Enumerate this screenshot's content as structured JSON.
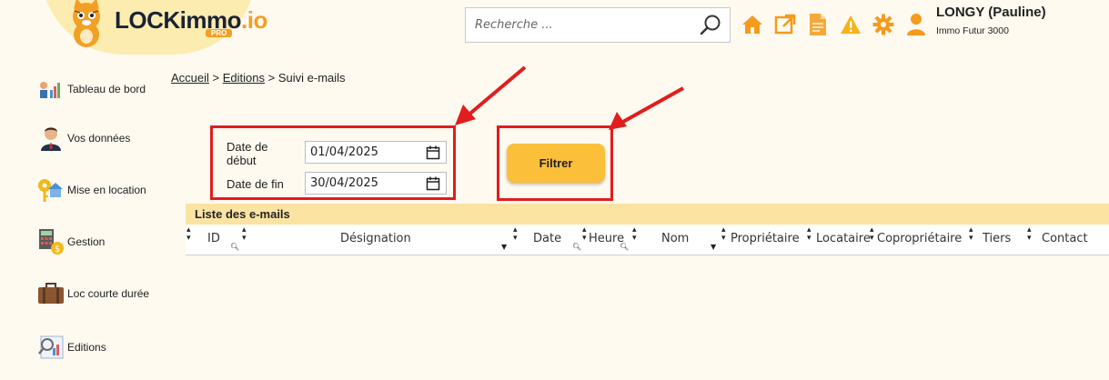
{
  "brand": {
    "logo_main": "LOCKimmo",
    "logo_suffix": ".io",
    "badge": "PRO",
    "accent": "#f2a023"
  },
  "search": {
    "placeholder": "Recherche ..."
  },
  "topbar_icons": [
    "home-icon",
    "external-link-icon",
    "document-icon",
    "alert-triangle-icon",
    "gear-icon",
    "user-icon"
  ],
  "user": {
    "name": "LONGY (Pauline)",
    "company": "Immo Futur 3000"
  },
  "sidebar": {
    "items": [
      {
        "label": "Tableau de bord",
        "icon": "dashboard-icon"
      },
      {
        "label": "Vos données",
        "icon": "person-icon"
      },
      {
        "label": "Mise en location",
        "icon": "key-house-icon"
      },
      {
        "label": "Gestion",
        "icon": "calculator-icon"
      },
      {
        "label": "Loc courte durée",
        "icon": "suitcase-icon"
      },
      {
        "label": "Editions",
        "icon": "report-icon"
      }
    ]
  },
  "breadcrumb": {
    "home": "Accueil",
    "sep": ">",
    "parent": "Editions",
    "current": "Suivi e-mails"
  },
  "filters": {
    "start_label": "Date de début",
    "start_value": "01/04/2025",
    "end_label": "Date de fin",
    "end_value": "30/04/2025",
    "button_label": "Filtrer"
  },
  "table": {
    "title": "Liste des e-mails",
    "columns": [
      "ID",
      "Désignation",
      "Date",
      "Heure",
      "Nom",
      "Propriétaire",
      "Locataire",
      "Copropriétaire",
      "Tiers",
      "Contact"
    ],
    "rows": []
  },
  "colors": {
    "highlight_red": "#e11d1d",
    "button_yellow": "#fbbf3a",
    "header_band": "#fbe3a2"
  }
}
